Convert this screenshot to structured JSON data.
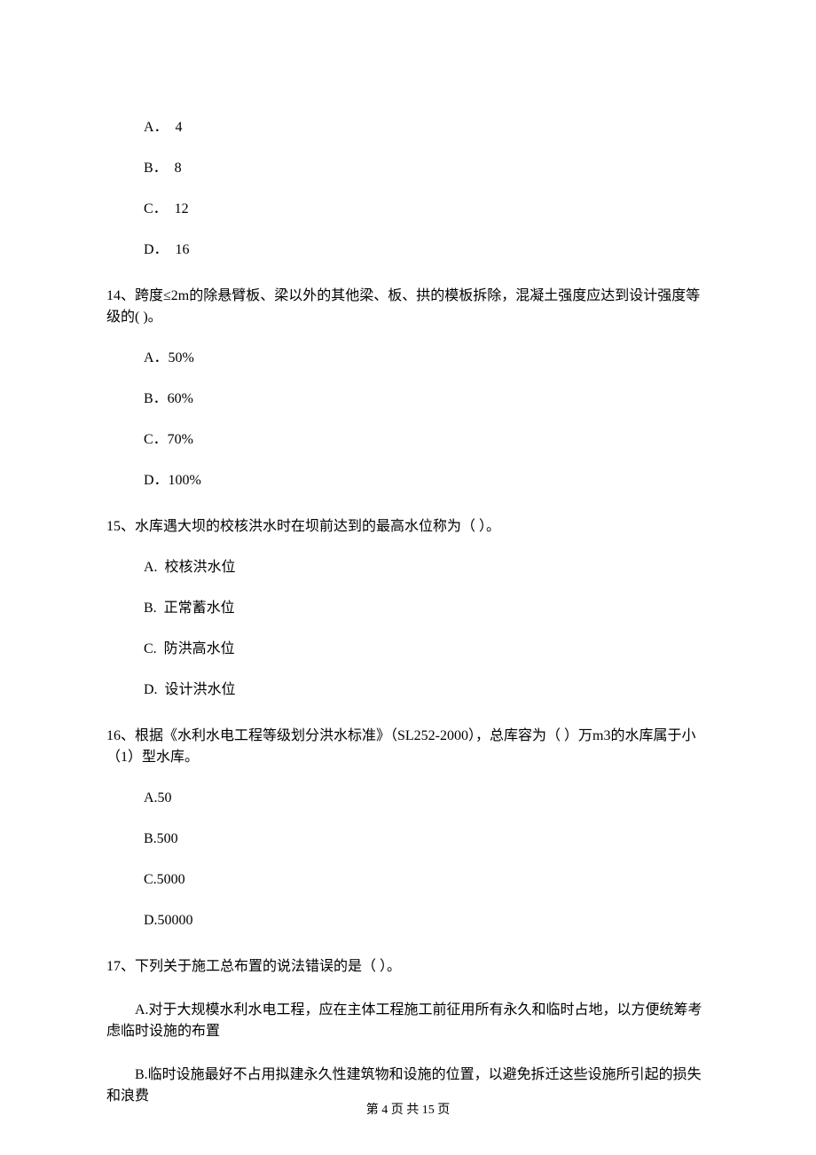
{
  "q13_options": {
    "a": "A．  4",
    "b": "B．  8",
    "c": "C．  12",
    "d": "D．  16"
  },
  "q14": {
    "stem": "14、跨度≤2m的除悬臂板、梁以外的其他梁、板、拱的模板拆除，混凝土强度应达到设计强度等级的(     )。",
    "a": "A．50%",
    "b": "B．60%",
    "c": "C．70%",
    "d": "D．100%"
  },
  "q15": {
    "stem": "15、水库遇大坝的校核洪水时在坝前达到的最高水位称为（    ）。",
    "a": "A.  校核洪水位",
    "b": "B.  正常蓄水位",
    "c": "C.  防洪高水位",
    "d": "D.  设计洪水位"
  },
  "q16": {
    "stem": "16、根据《水利水电工程等级划分洪水标准》（SL252-2000），总库容为（   ）万m3的水库属于小（1）型水库。",
    "a": "A.50",
    "b": "B.500",
    "c": "C.5000",
    "d": "D.50000"
  },
  "q17": {
    "stem": "17、下列关于施工总布置的说法错误的是（     ）。",
    "a": "A.对于大规模水利水电工程，应在主体工程施工前征用所有永久和临时占地，以方便统筹考虑临时设施的布置",
    "b": "B.临时设施最好不占用拟建永久性建筑物和设施的位置，以避免拆迁这些设施所引起的损失和浪费"
  },
  "footer": "第 4 页 共 15 页"
}
